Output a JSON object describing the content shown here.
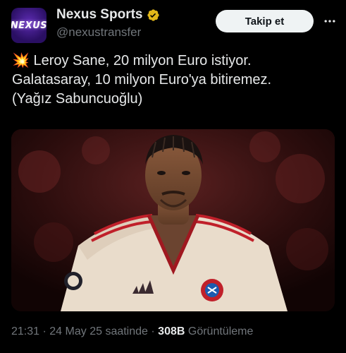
{
  "author": {
    "avatar_text": "NEXUS",
    "display_name": "Nexus Sports",
    "handle": "@nexustransfer",
    "verified_icon": "verified-badge-icon"
  },
  "follow_button": {
    "label": "Takip et"
  },
  "more_menu": {
    "icon": "more-dots-icon"
  },
  "tweet": {
    "emoji": "💥",
    "lines": [
      "Leroy Sane, 20 milyon Euro istiyor.",
      "Galatasaray, 10 milyon Euro'ya bitiremez.",
      "(Yağız Sabuncuoğlu)"
    ]
  },
  "media": {
    "type": "photo",
    "subject": "football player in cream and red kit",
    "jersey_badge_text": "FC BAYERN MÜNCHEN"
  },
  "meta": {
    "time": "21:31",
    "separator": "·",
    "date": "24 May 25 saatinde",
    "views_count": "308B",
    "views_label": "Görüntüleme"
  },
  "colors": {
    "background": "#000000",
    "text_primary": "#e7e9ea",
    "text_secondary": "#71767b",
    "verified": "#e2b719",
    "button_bg": "#eff3f4"
  }
}
